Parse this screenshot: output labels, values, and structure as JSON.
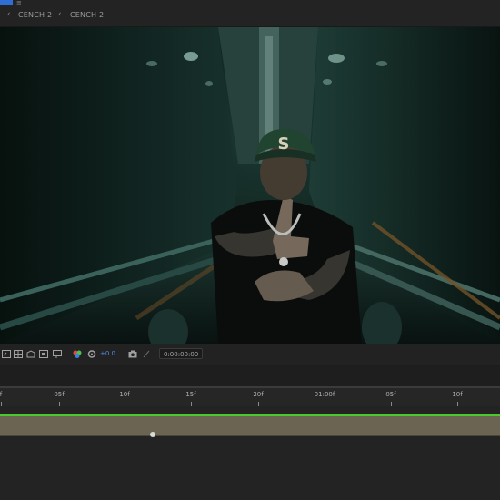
{
  "breadcrumb": {
    "items": [
      "CENCH 2",
      "CENCH 2"
    ],
    "separator_icon": "chevron-left-icon"
  },
  "viewer_toolbar": {
    "exposure_value": "+0.0",
    "timecode": "0:00:00:00",
    "icons": [
      "region-of-interest-icon",
      "transparency-grid-icon",
      "mask-icon",
      "safe-margins-icon",
      "channel-icon",
      "color-wheel-icon",
      "gear-icon",
      "camera-icon",
      "snapshot-icon"
    ]
  },
  "timeline": {
    "ruler_labels": [
      "f",
      "05f",
      "10f",
      "15f",
      "20f",
      "01:00f",
      "05f",
      "10f"
    ],
    "workarea_color": "#4cc92f",
    "layer_color": "#6b6452"
  },
  "viewer": {
    "frame_description_colors": {
      "tunnel": "#0f2723",
      "light": "#6f9e94",
      "rail_warm": "#7a5a2c"
    }
  }
}
